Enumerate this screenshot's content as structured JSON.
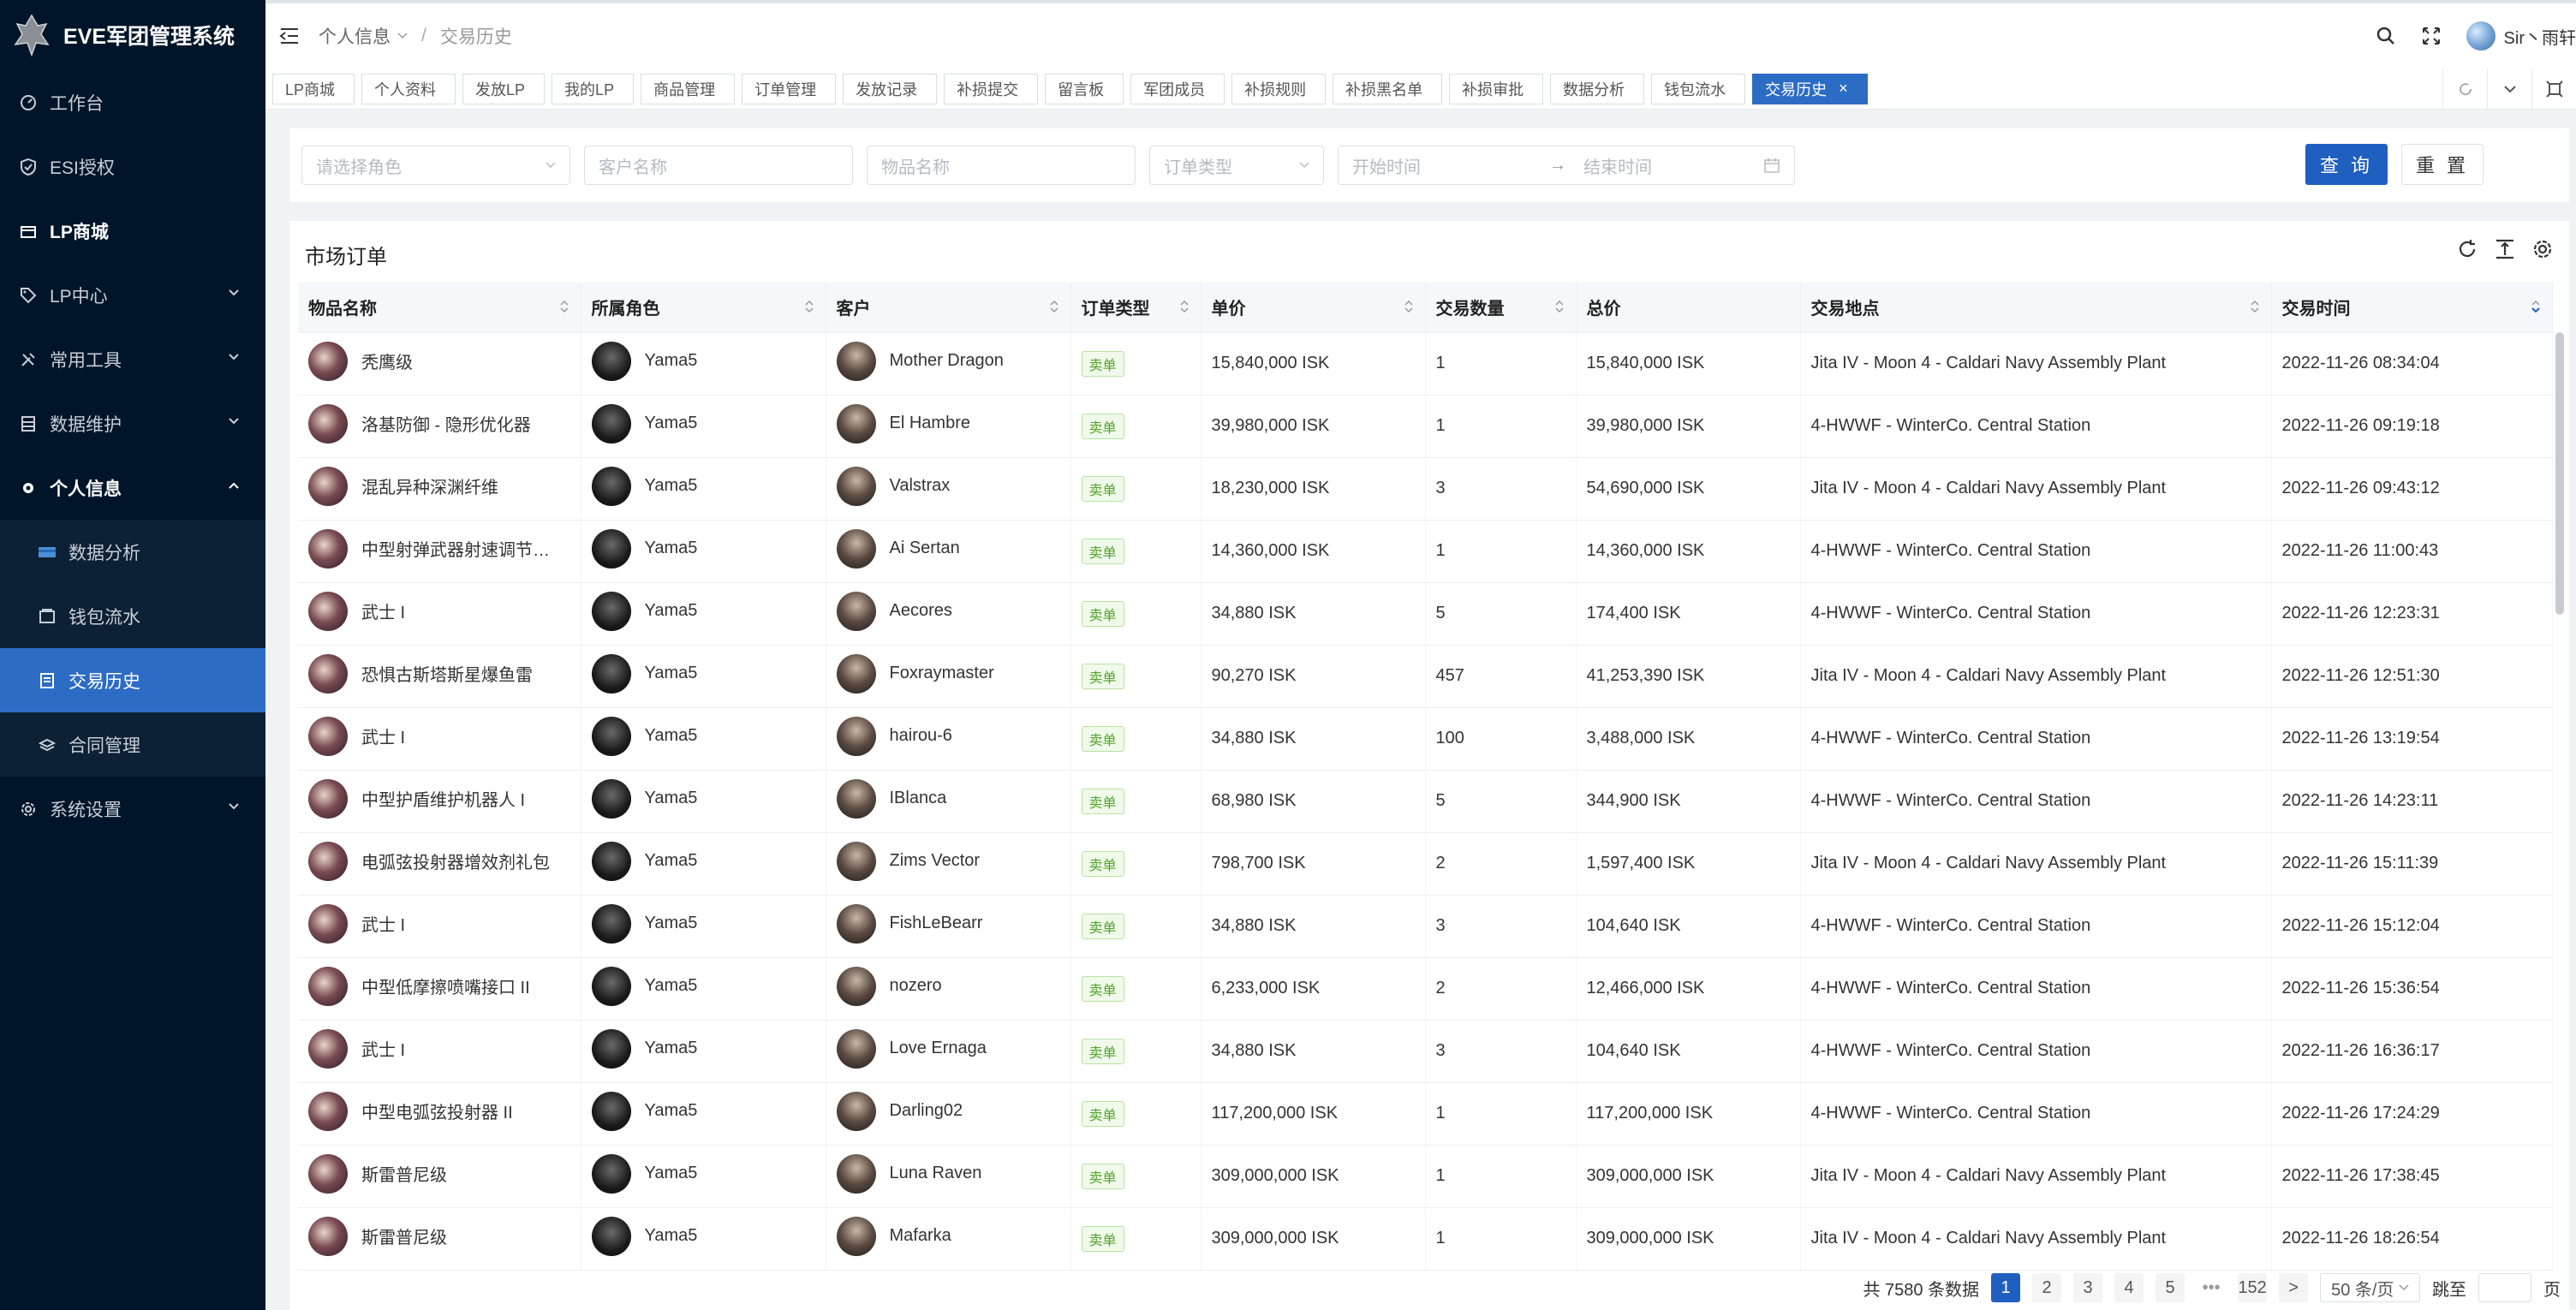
{
  "app": {
    "title": "EVE军团管理系统"
  },
  "sidebar": {
    "items": [
      {
        "label": "工作台",
        "icon": "dashboard-icon"
      },
      {
        "label": "ESI授权",
        "icon": "shield-check-icon"
      },
      {
        "label": "LP商城",
        "icon": "shop-icon"
      },
      {
        "label": "LP中心",
        "icon": "tag-icon"
      },
      {
        "label": "常用工具",
        "icon": "tools-icon"
      },
      {
        "label": "数据维护",
        "icon": "database-icon"
      },
      {
        "label": "个人信息",
        "icon": "user-gear-icon"
      },
      {
        "label": "系统设置",
        "icon": "gear-icon"
      }
    ],
    "submenu": [
      {
        "label": "数据分析",
        "icon": "chart-card-icon"
      },
      {
        "label": "钱包流水",
        "icon": "wallet-icon"
      },
      {
        "label": "交易历史",
        "icon": "trade-history-icon"
      },
      {
        "label": "合同管理",
        "icon": "contract-icon"
      }
    ]
  },
  "header": {
    "breadcrumb": [
      "个人信息",
      "交易历史"
    ],
    "username": "Sir丶雨轩"
  },
  "tabs": [
    "LP商城",
    "个人资料",
    "发放LP",
    "我的LP",
    "商品管理",
    "订单管理",
    "发放记录",
    "补损提交",
    "留言板",
    "军团成员",
    "补损规则",
    "补损黑名单",
    "补损审批",
    "数据分析",
    "钱包流水",
    "交易历史"
  ],
  "filters": {
    "role_placeholder": "请选择角色",
    "customer_placeholder": "客户名称",
    "item_placeholder": "物品名称",
    "type_placeholder": "订单类型",
    "start_placeholder": "开始时间",
    "arrow": "→",
    "end_placeholder": "结束时间",
    "query_label": "查 询",
    "reset_label": "重 置"
  },
  "table": {
    "title": "市场订单",
    "columns": [
      "物品名称",
      "所属角色",
      "客户",
      "订单类型",
      "单价",
      "交易数量",
      "总价",
      "交易地点",
      "交易时间"
    ],
    "rows": [
      [
        "秃鹰级",
        "Yama5",
        "Mother Dragon",
        "卖单",
        "15,840,000 ISK",
        "1",
        "15,840,000 ISK",
        "Jita IV - Moon 4 - Caldari Navy Assembly Plant",
        "2022-11-26 08:34:04"
      ],
      [
        "洛基防御 - 隐形优化器",
        "Yama5",
        "El Hambre",
        "卖单",
        "39,980,000 ISK",
        "1",
        "39,980,000 ISK",
        "4-HWWF - WinterCo. Central Station",
        "2022-11-26 09:19:18"
      ],
      [
        "混乱异种深渊纤维",
        "Yama5",
        "Valstrax",
        "卖单",
        "18,230,000 ISK",
        "3",
        "54,690,000 ISK",
        "Jita IV - Moon 4 - Caldari Navy Assembly Plant",
        "2022-11-26 09:43:12"
      ],
      [
        "中型射弹武器射速调节…",
        "Yama5",
        "Ai Sertan",
        "卖单",
        "14,360,000 ISK",
        "1",
        "14,360,000 ISK",
        "4-HWWF - WinterCo. Central Station",
        "2022-11-26 11:00:43"
      ],
      [
        "武士 I",
        "Yama5",
        "Aecores",
        "卖单",
        "34,880 ISK",
        "5",
        "174,400 ISK",
        "4-HWWF - WinterCo. Central Station",
        "2022-11-26 12:23:31"
      ],
      [
        "恐惧古斯塔斯星爆鱼雷",
        "Yama5",
        "Foxraymaster",
        "卖单",
        "90,270 ISK",
        "457",
        "41,253,390 ISK",
        "Jita IV - Moon 4 - Caldari Navy Assembly Plant",
        "2022-11-26 12:51:30"
      ],
      [
        "武士 I",
        "Yama5",
        "hairou-6",
        "卖单",
        "34,880 ISK",
        "100",
        "3,488,000 ISK",
        "4-HWWF - WinterCo. Central Station",
        "2022-11-26 13:19:54"
      ],
      [
        "中型护盾维护机器人 I",
        "Yama5",
        "IBlanca",
        "卖单",
        "68,980 ISK",
        "5",
        "344,900 ISK",
        "4-HWWF - WinterCo. Central Station",
        "2022-11-26 14:23:11"
      ],
      [
        "电弧弦投射器增效剂礼包",
        "Yama5",
        "Zims Vector",
        "卖单",
        "798,700 ISK",
        "2",
        "1,597,400 ISK",
        "Jita IV - Moon 4 - Caldari Navy Assembly Plant",
        "2022-11-26 15:11:39"
      ],
      [
        "武士 I",
        "Yama5",
        "FishLeBearr",
        "卖单",
        "34,880 ISK",
        "3",
        "104,640 ISK",
        "4-HWWF - WinterCo. Central Station",
        "2022-11-26 15:12:04"
      ],
      [
        "中型低摩擦喷嘴接口 II",
        "Yama5",
        "nozero",
        "卖单",
        "6,233,000 ISK",
        "2",
        "12,466,000 ISK",
        "4-HWWF - WinterCo. Central Station",
        "2022-11-26 15:36:54"
      ],
      [
        "武士 I",
        "Yama5",
        "Love Ernaga",
        "卖单",
        "34,880 ISK",
        "3",
        "104,640 ISK",
        "4-HWWF - WinterCo. Central Station",
        "2022-11-26 16:36:17"
      ],
      [
        "中型电弧弦投射器 II",
        "Yama5",
        "Darling02",
        "卖单",
        "117,200,000 ISK",
        "1",
        "117,200,000 ISK",
        "4-HWWF - WinterCo. Central Station",
        "2022-11-26 17:24:29"
      ],
      [
        "斯雷普尼级",
        "Yama5",
        "Luna Raven",
        "卖单",
        "309,000,000 ISK",
        "1",
        "309,000,000 ISK",
        "Jita IV - Moon 4 - Caldari Navy Assembly Plant",
        "2022-11-26 17:38:45"
      ],
      [
        "斯雷普尼级",
        "Yama5",
        "Mafarka",
        "卖单",
        "309,000,000 ISK",
        "1",
        "309,000,000 ISK",
        "Jita IV - Moon 4 - Caldari Navy Assembly Plant",
        "2022-11-26 18:26:54"
      ]
    ]
  },
  "pagination": {
    "total": "共 7580 条数据",
    "pages": [
      "1",
      "2",
      "3",
      "4",
      "5"
    ],
    "ellipsis": "•••",
    "last": "152",
    "next": ">",
    "page_size": "50 条/页",
    "goto_label": "跳至",
    "page_unit": "页"
  },
  "colors": {
    "sidebar_bg": "#001529",
    "primary": "#1f5fbf",
    "sell_badge": "#52a32b"
  }
}
